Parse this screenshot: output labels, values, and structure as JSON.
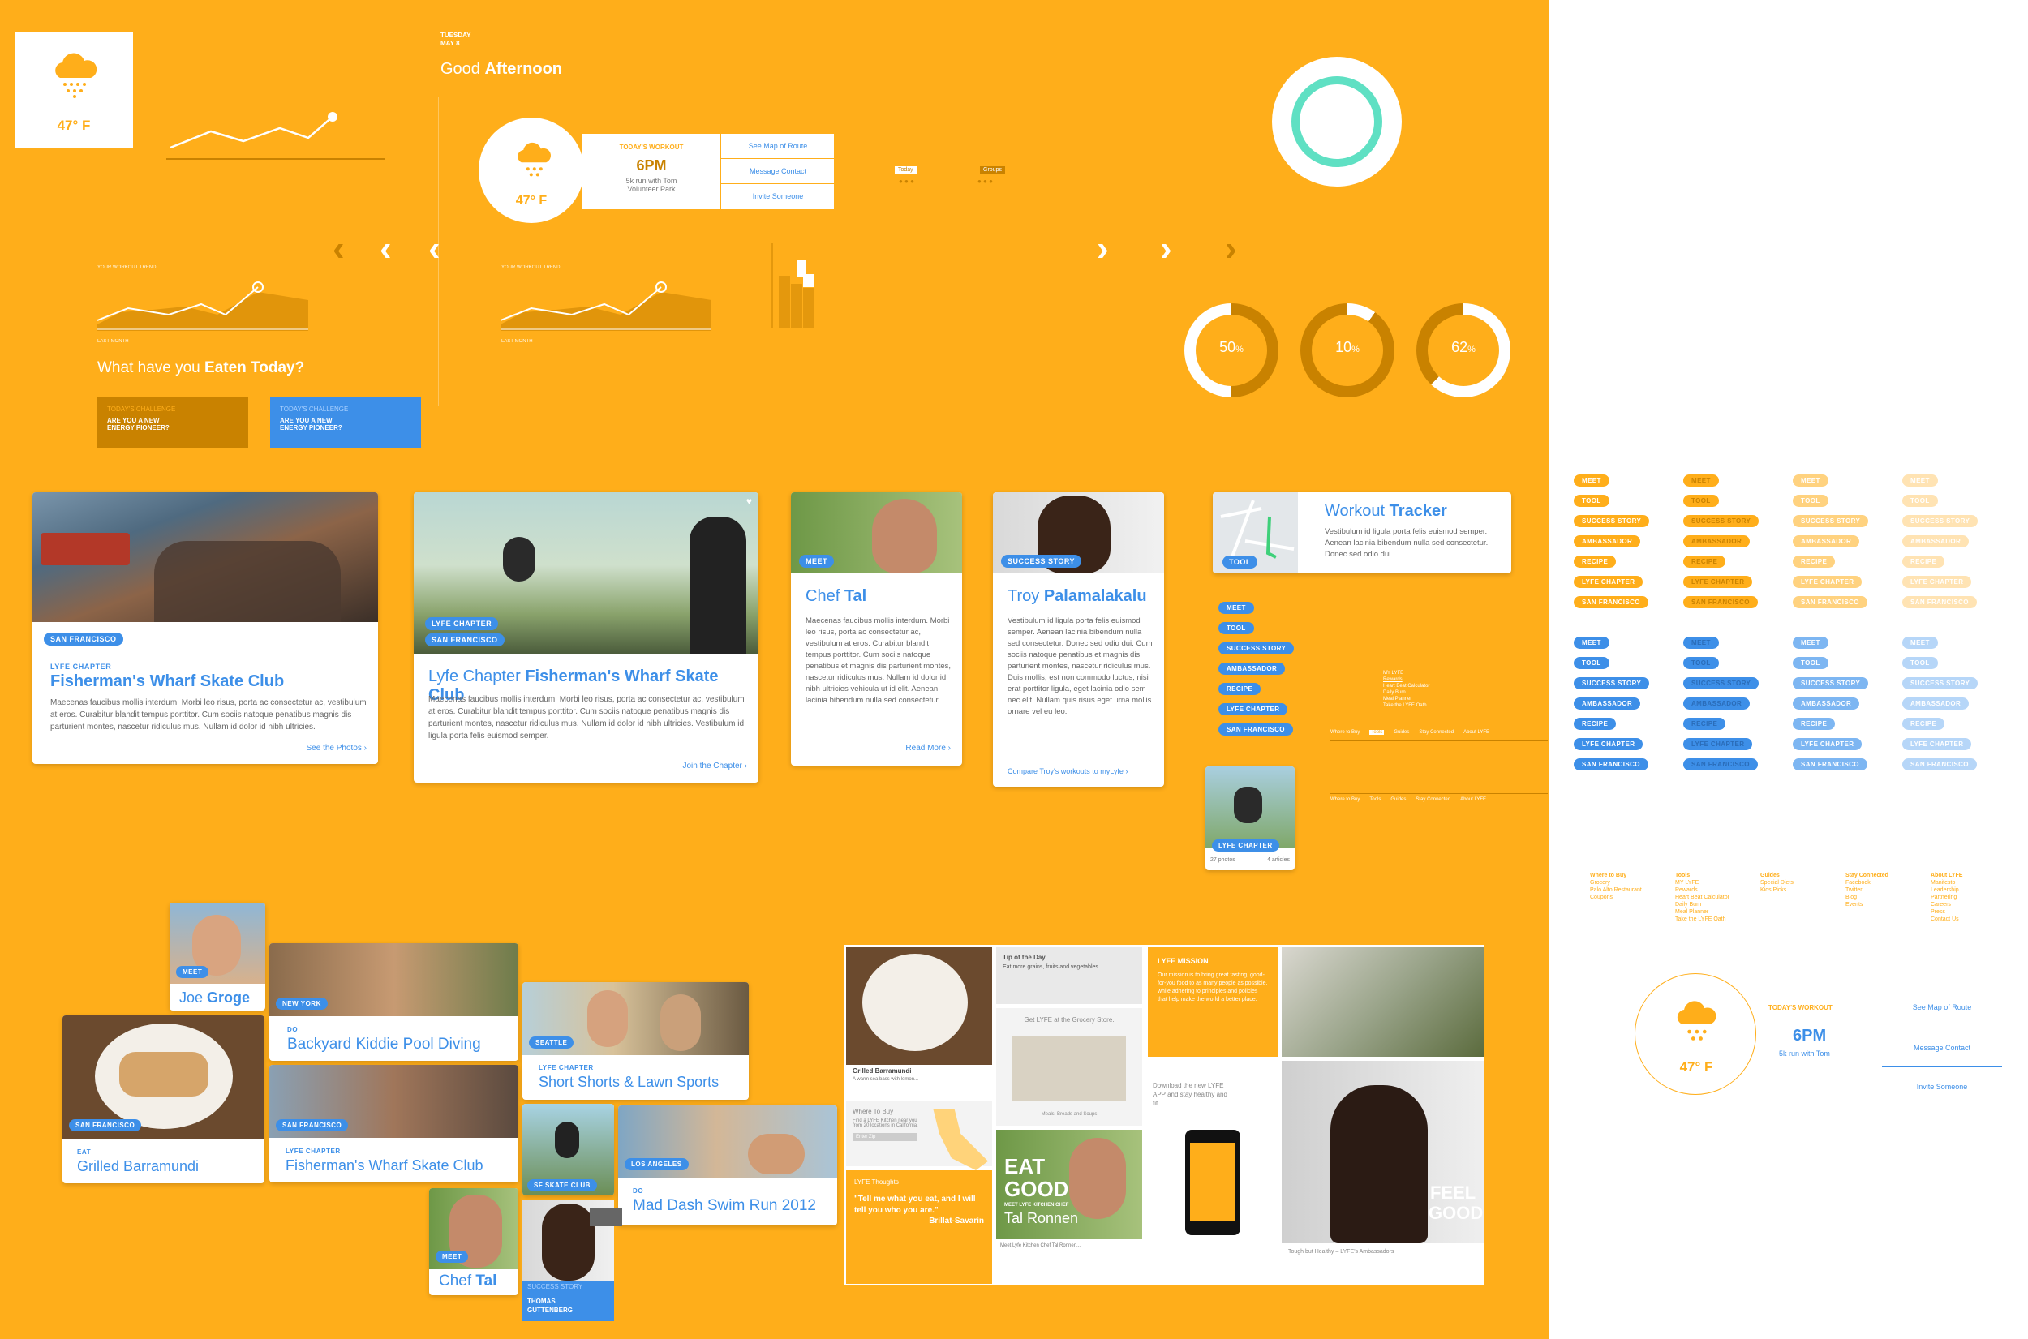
{
  "colors": {
    "orange": "#FFAE1A",
    "blue": "#3D8FE8",
    "dark_orange": "#C98200",
    "teal": "#5FE0C3",
    "white": "#FFFFFF"
  },
  "weather": {
    "temp": "47° F",
    "icon": "cloud-rain-icon"
  },
  "greeting": {
    "day": "TUESDAY",
    "date": "MAY 8",
    "text_light": "Good ",
    "text_bold": "Afternoon"
  },
  "workout": {
    "label": "TODAY'S WORKOUT",
    "time": "6PM",
    "desc1": "5k run with Tom",
    "desc2": "Volunteer Park",
    "link1": "See Map of Route",
    "link2": "Message Contact",
    "link3": "Invite Someone"
  },
  "tabs_small": {
    "today": "Today",
    "groups": "Groups"
  },
  "trend": {
    "label": "YOUR WORKOUT TREND",
    "last": "LAST MONTH"
  },
  "eaten": {
    "light": "What have you ",
    "bold": "Eaten Today?"
  },
  "challenge": {
    "label": "TODAY'S CHALLENGE",
    "text1": "ARE YOU A NEW",
    "text2": "ENERGY PIONEER?"
  },
  "donuts": [
    {
      "value": "50",
      "unit": "%"
    },
    {
      "value": "10",
      "unit": "%"
    },
    {
      "value": "62",
      "unit": "%"
    }
  ],
  "card1": {
    "tag": "SAN FRANCISCO",
    "kicker": "LYFE CHAPTER",
    "title": "Fisherman's Wharf Skate Club",
    "body": "Maecenas faucibus mollis interdum. Morbi leo risus, porta ac consectetur ac, vestibulum at eros. Curabitur blandit tempus porttitor. Cum sociis natoque penatibus magnis dis parturient montes, nascetur ridiculus mus. Nullam id dolor id nibh ultricies.",
    "more": "See the Photos"
  },
  "card2": {
    "tag1": "LYFE CHAPTER",
    "tag2": "SAN FRANCISCO",
    "title_light": "Lyfe Chapter ",
    "title_bold": "Fisherman's Wharf Skate Club",
    "body": "Maecenas faucibus mollis interdum. Morbi leo risus, porta ac consectetur ac, vestibulum at eros. Curabitur blandit tempus porttitor. Cum sociis natoque penatibus magnis dis parturient montes, nascetur ridiculus mus. Nullam id dolor id nibh ultricies. Vestibulum id ligula porta felis euismod semper.",
    "more": "Join the Chapter"
  },
  "card3": {
    "tag": "MEET",
    "title_light": "Chef ",
    "title_bold": "Tal",
    "body": "Maecenas faucibus mollis interdum. Morbi leo risus, porta ac consectetur ac, vestibulum at eros. Curabitur blandit tempus porttitor. Cum sociis natoque penatibus et magnis dis parturient montes, nascetur ridiculus mus. Nullam id dolor id nibh ultricies vehicula ut id elit. Aenean lacinia bibendum nulla sed consectetur.",
    "more": "Read More"
  },
  "card4": {
    "tag": "SUCCESS STORY",
    "title_light": "Troy ",
    "title_bold": "Palamalakalu",
    "body": "Vestibulum id ligula porta felis euismod semper. Aenean lacinia bibendum nulla sed consectetur. Donec sed odio dui. Cum sociis natoque penatibus et magnis dis parturient montes, nascetur ridiculus mus. Duis mollis, est non commodo luctus, nisi erat porttitor ligula, eget lacinia odio sem nec elit. Nullam quis risus eget urna mollis ornare vel eu leo.",
    "more": "Compare Troy's workouts to myLyfe"
  },
  "tracker": {
    "tag": "TOOL",
    "title_light": "Workout ",
    "title_bold": "Tracker",
    "body": "Vestibulum id ligula porta felis euismod semper. Aenean lacinia bibendum nulla sed consectetur. Donec sed odio dui."
  },
  "pill_labels": [
    "MEET",
    "TOOL",
    "SUCCESS STORY",
    "AMBASSADOR",
    "RECIPE",
    "LYFE CHAPTER",
    "SAN FRANCISCO"
  ],
  "nav_lists": {
    "tool_items": [
      "MY LYFE",
      "Rewards",
      "Heart Beat Calculator",
      "Daily Burn",
      "Meal Planner",
      "Take the LYFE Oath"
    ],
    "bar": [
      "Where to Buy",
      "Tools",
      "Guides",
      "Stay Connected",
      "About LYFE"
    ]
  },
  "skate_thumb": {
    "tag": "LYFE CHAPTER",
    "photos": "27 photos",
    "articles": "4 articles"
  },
  "footer_menu": [
    {
      "head": "Where to Buy",
      "items": [
        "Grocery",
        "Palo Alto Restaurant",
        "Coupons"
      ]
    },
    {
      "head": "Tools",
      "items": [
        "MY LYFE",
        "Rewards",
        "Heart Beat Calculator",
        "Daily Burn",
        "Meal Planner",
        "Take the LYFE Oath"
      ]
    },
    {
      "head": "Guides",
      "items": [
        "Special Diets",
        "Kids Picks"
      ]
    },
    {
      "head": "Stay Connected",
      "items": [
        "Facebook",
        "Twitter",
        "Blog",
        "Events"
      ]
    },
    {
      "head": "About LYFE",
      "items": [
        "Manifesto",
        "Leadership",
        "Partnering",
        "Careers",
        "Press",
        "Contact Us"
      ]
    }
  ],
  "widget_white": {
    "temp": "47° F",
    "label": "TODAY'S WORKOUT",
    "time": "6PM",
    "desc": "5k run with Tom",
    "link1": "See Map of Route",
    "link2": "Message Contact",
    "link3": "Invite Someone"
  },
  "tiles": {
    "joe": {
      "tag": "MEET",
      "title_light": "Joe ",
      "title_bold": "Groge"
    },
    "pool": {
      "tag": "NEW YORK",
      "kicker": "DO",
      "title": "Backyard Kiddie Pool Diving"
    },
    "seattle": {
      "tag": "SEATTLE",
      "kicker": "LYFE CHAPTER",
      "title": "Short Shorts & Lawn Sports"
    },
    "barra": {
      "tag": "SAN FRANCISCO",
      "kicker": "EAT",
      "title": "Grilled Barramundi"
    },
    "wharf": {
      "tag": "SAN FRANCISCO",
      "kicker": "LYFE CHAPTER",
      "title": "Fisherman's Wharf Skate Club"
    },
    "sf_skate": {
      "tag": "SF SKATE CLUB"
    },
    "swim": {
      "tag": "LOS ANGELES",
      "kicker": "DO",
      "title": "Mad Dash Swim Run 2012"
    },
    "chef": {
      "tag": "MEET",
      "title_light": "Chef ",
      "title_bold": "Tal"
    },
    "thomas": {
      "label": "SUCCESS STORY",
      "name1": "THOMAS",
      "name2": "GUTTENBERG"
    }
  },
  "collage": {
    "grilled": "Grilled Barramundi",
    "grilled_desc": "A warm sea bass with lemon...",
    "tip_head": "Tip of the Day",
    "tip_body": "Eat more grains, fruits and vegetables.",
    "grocery": "Get LYFE at the Grocery Store.",
    "meals": "Meals, Breads and Soups",
    "mission_head": "LYFE MISSION",
    "mission_body": "Our mission is to bring great tasting, good-for-you food to as many people as possible, while adhering to principles and policies that help make the world a better place.",
    "where": "Where To Buy",
    "where_body": "Find a LYFE Kitchen near you from 20 locations in California.",
    "zip": "Enter Zip",
    "eat1": "EAT",
    "eat2": "GOOD",
    "meet_chef": "MEET LYFE KITCHEN CHEF",
    "chef_name": "Tal Ronnen",
    "chef_foot": "Meet Lyfe Kitchen Chef Tal Ronnen...",
    "download": "Download the new LYFE APP and stay healthy and fit.",
    "thoughts": "LYFE Thoughts",
    "quote": "\"Tell me what you eat, and I will tell you who you are.\"",
    "quote_by": "—Brillat-Savarin",
    "feel1": "FEEL",
    "feel2": "GOOD",
    "tough": "Tough but Healthy – LYFE's Ambassadors"
  }
}
